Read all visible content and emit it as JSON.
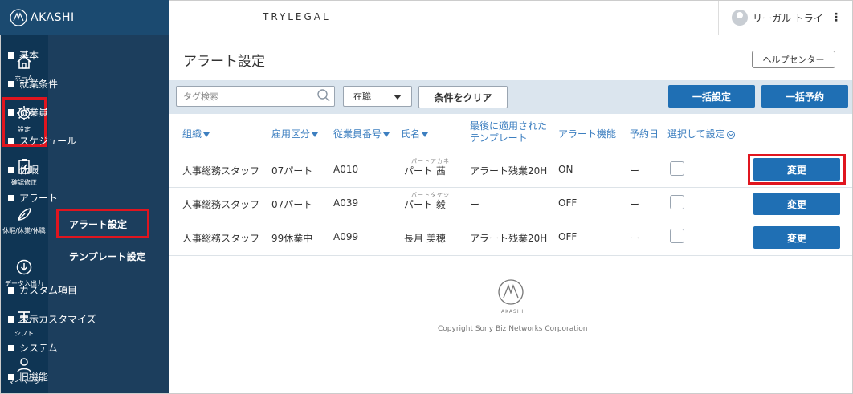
{
  "brand": {
    "name": "AKASHI"
  },
  "rail": [
    {
      "label": "ホーム",
      "icon": "home-icon"
    },
    {
      "label": "設定",
      "icon": "gear-icon"
    },
    {
      "label": "確認修正",
      "icon": "clipboard-check-icon"
    },
    {
      "label": "休暇/休業/休職",
      "icon": "leaf-icon"
    },
    {
      "label": "データ入出力",
      "icon": "download-circle-icon"
    },
    {
      "label": "シフト",
      "icon": "shift-icon"
    },
    {
      "label": "マイページ",
      "icon": "person-icon"
    }
  ],
  "menu": {
    "items": [
      "基本",
      "就業条件",
      "従業員",
      "スケジュール",
      "休暇",
      "アラート",
      "カスタム項目",
      "表示カスタマイズ",
      "システム",
      "旧機能"
    ],
    "sub": [
      "アラート設定",
      "テンプレート設定"
    ]
  },
  "header": {
    "company": "TRYLEGAL",
    "user": "リーガル トライ"
  },
  "page": {
    "title": "アラート設定",
    "help": "ヘルプセンター"
  },
  "toolbar": {
    "search_placeholder": "タグ検索",
    "status": "在職",
    "clear": "条件をクリア",
    "bulk_set": "一括設定",
    "bulk_reserve": "一括予約"
  },
  "table": {
    "headers": {
      "org": "組織",
      "emp_type": "雇用区分",
      "emp_no": "従業員番号",
      "name": "氏名",
      "template_l1": "最後に適用された",
      "template_l2": "テンプレート",
      "alert": "アラート機能",
      "reserve": "予約日",
      "select": "選択して設定"
    },
    "rows": [
      {
        "org": "人事総務スタッフ",
        "type": "07パート",
        "no": "A010",
        "ruby": "パートアカネ",
        "name": "パート 茜",
        "template": "アラート残業20H",
        "alert": "ON",
        "reserve": "ー",
        "action": "変更"
      },
      {
        "org": "人事総務スタッフ",
        "type": "07パート",
        "no": "A039",
        "ruby": "パートタケシ",
        "name": "パート 毅",
        "template": "ー",
        "alert": "OFF",
        "reserve": "ー",
        "action": "変更"
      },
      {
        "org": "人事総務スタッフ",
        "type": "99休業中",
        "no": "A099",
        "ruby": "",
        "name": "長月 美穂",
        "template": "アラート残業20H",
        "alert": "OFF",
        "reserve": "ー",
        "action": "変更"
      }
    ]
  },
  "footer": {
    "brand": "AKASHI",
    "copyright": "Copyright Sony Biz Networks Corporation"
  },
  "colors": {
    "rail": "#0f3554",
    "menu": "#1c3e5d",
    "primary": "#1f6fb4",
    "highlight": "#e0151f",
    "link": "#3d7fc0"
  }
}
